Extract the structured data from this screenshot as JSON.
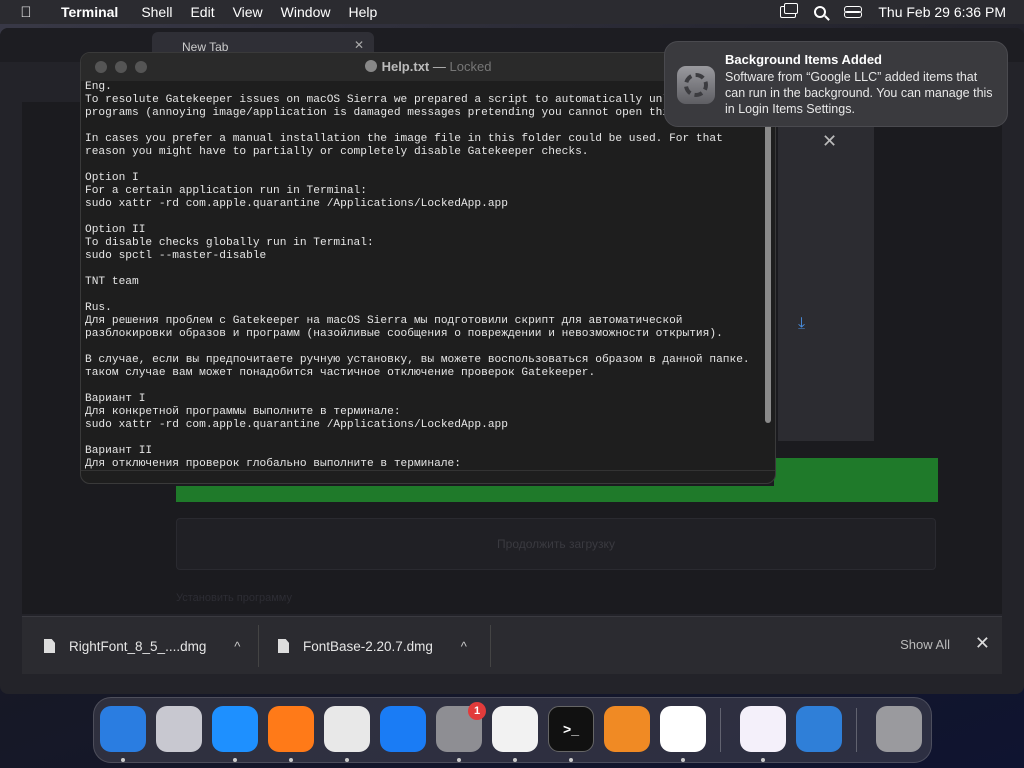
{
  "menubar": {
    "apple": "",
    "app_name": "Terminal",
    "items": [
      "Shell",
      "Edit",
      "View",
      "Window",
      "Help"
    ],
    "clock": "Thu Feb 29  6:36 PM"
  },
  "browser": {
    "tab_title": "New Tab",
    "dialog_close": "✕",
    "download_glyph": "⤓",
    "faded_button": "Продолжить загрузку",
    "faded_row": "Установить программу"
  },
  "terminal": {
    "title": "Help.txt",
    "title_sep": "—",
    "status": "Locked",
    "text": "Eng.\nTo resolute Gatekeeper issues on macOS Sierra we prepared a script to automatically unlo\nprograms (annoying image/application is damaged messages pretending you cannot open thi\n\nIn cases you prefer a manual installation the image file in this folder could be used. For that\nreason you might have to partially or completely disable Gatekeeper checks.\n\nOption I\nFor a certain application run in Terminal:\nsudo xattr -rd com.apple.quarantine /Applications/LockedApp.app\n\nOption II\nTo disable checks globally run in Terminal:\nsudo spctl --master-disable\n\nTNT team\n\nRus.\nДля решения проблем с Gatekeeper на macOS Sierra мы подготовили скрипт для автоматической\nразблокировки образов и программ (назойливые сообщения о повреждении и невозможности открытия).\n\nВ случае, если вы предпочитаете ручную установку, вы можете воспользоваться образом в данной папке. В\nтаком случае вам может понадобится частичное отключение проверок Gatekeeper.\n\nВариант I\nДля конкретной программы выполните в терминале:\nsudo xattr -rd com.apple.quarantine /Applications/LockedApp.app\n\nВариант II\nДля отключения проверок глобально выполните в терминале:"
  },
  "notification": {
    "title": "Background Items Added",
    "body": "Software from “Google LLC” added items that can run in the background. You can manage this in Login Items Settings."
  },
  "downloads": {
    "items": [
      {
        "name": "RightFont_8_5_....dmg"
      },
      {
        "name": "FontBase-2.20.7.dmg"
      }
    ],
    "caret": "^",
    "show_all": "Show All",
    "close": "✕"
  },
  "dock": {
    "badge": "1",
    "apps": [
      {
        "name": "finder",
        "color": "#2a7de1"
      },
      {
        "name": "launchpad",
        "color": "#c8c8d0"
      },
      {
        "name": "safari",
        "color": "#1e90ff"
      },
      {
        "name": "firefox",
        "color": "#ff7a18"
      },
      {
        "name": "chrome",
        "color": "#e8e8e8"
      },
      {
        "name": "app-store",
        "color": "#1a7cf5"
      },
      {
        "name": "system-settings",
        "color": "#8e8e93"
      },
      {
        "name": "textedit",
        "color": "#f2f2f2"
      },
      {
        "name": "terminal",
        "color": "#111111"
      },
      {
        "name": "garageband",
        "color": "#f08a24"
      },
      {
        "name": "vscode",
        "color": "#ffffff"
      },
      {
        "name": "visual-studio",
        "color": "#f4f0fa"
      },
      {
        "name": "weather",
        "color": "#2f7fd8"
      },
      {
        "name": "trash",
        "color": "#9a9a9e"
      }
    ],
    "terminal_glyph": ">_"
  }
}
